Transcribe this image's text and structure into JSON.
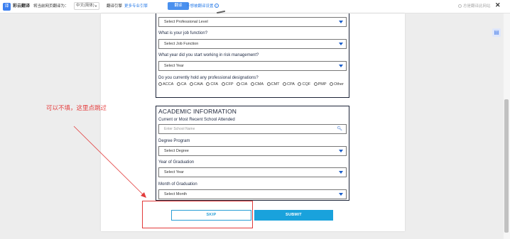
{
  "toolbar": {
    "app_name": "彩云翻译",
    "translate_label": "将当前网页翻译为：",
    "language_value": "中文(简体)",
    "engine_label": "翻译引擎",
    "engine_link": "更多专业引擎",
    "translate_button": "翻译",
    "settings_link": "不想被翻译设置",
    "always_label": "总是翻译此网站",
    "close_glyph": "✕"
  },
  "professional": {
    "professional_level_value": "Select Professional Level",
    "job_function_label": "What is your job function?",
    "job_function_value": "Select Job Function",
    "risk_year_label": "What year did you start working in risk management?",
    "risk_year_value": "Select Year",
    "designations_label": "Do you currently hold any professional designations?",
    "designations": [
      "ACCA",
      "CA",
      "CAIA",
      "CFA",
      "CFP",
      "CIA",
      "CMA",
      "CMT",
      "CPA",
      "CQF",
      "PMP",
      "Other"
    ]
  },
  "academic": {
    "title": "ACADEMIC INFORMATION",
    "school_label": "Current or Most Recent School Attended",
    "school_placeholder": "Enter School Name",
    "degree_label": "Degree Program",
    "degree_value": "Select Degree",
    "grad_year_label": "Year of Graduation",
    "grad_year_value": "Select Year",
    "grad_month_label": "Month of Graduation",
    "grad_month_value": "Select Month"
  },
  "buttons": {
    "skip": "SKIP",
    "submit": "SUBMIT"
  },
  "annotation": {
    "note": "可以不填，这里点跳过",
    "color": "#e23b3b"
  },
  "icons": {
    "dropdown": "triangle-down-icon",
    "search": "search-icon",
    "side_panel": "side-panel-icon"
  }
}
